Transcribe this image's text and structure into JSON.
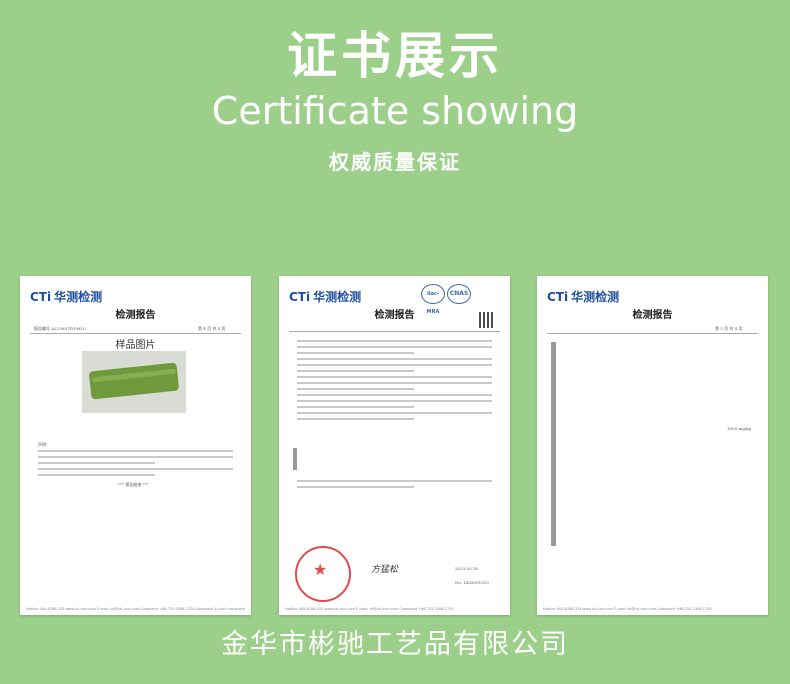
{
  "header": {
    "title_cn": "证书展示",
    "title_en": "Certificate showing",
    "subtitle": "权威质量保证"
  },
  "documents": [
    {
      "logo_mark": "CTi",
      "logo_text": "华测检测",
      "report_title": "检测报告",
      "report_no": "报告编号   A2230S7D1991C",
      "page": "第 4 页  共 4 页",
      "section_title": "样品图片",
      "notes_heading": "声明：",
      "end_mark": "*** 报告结束 ***",
      "footer": "Hotline 400-6788-333  www.cti-cert.com  E-mail: cti@cti-cert.com  Complaint +86-755-3368 1700  Complaint E-mail: complaint@cti-cert.com"
    },
    {
      "logo_mark": "CTi",
      "logo_text": "华测检测",
      "report_title": "检测报告",
      "badge_ilac": "ilac-MRA",
      "badge_cnas": "CNAS",
      "sign_name": "方猛松",
      "date": "2023.03.18",
      "report_no": "No. 1428051013",
      "footer": "Hotline 400-6788-333  www.cti-cert.com  E-mail: cti@cti-cert.com  Complaint +86-755-3368 1700"
    },
    {
      "logo_mark": "CTi",
      "logo_text": "华测检测",
      "report_title": "检测报告",
      "page": "第 3 页  共 4 页",
      "unit": "1000 mg/kg",
      "footer": "Hotline 400-6788-333  www.cti-cert.com  E-mail: cti@cti-cert.com  Complaint +86-755-3368 1700"
    }
  ],
  "company": "金华市彬驰工艺品有限公司"
}
